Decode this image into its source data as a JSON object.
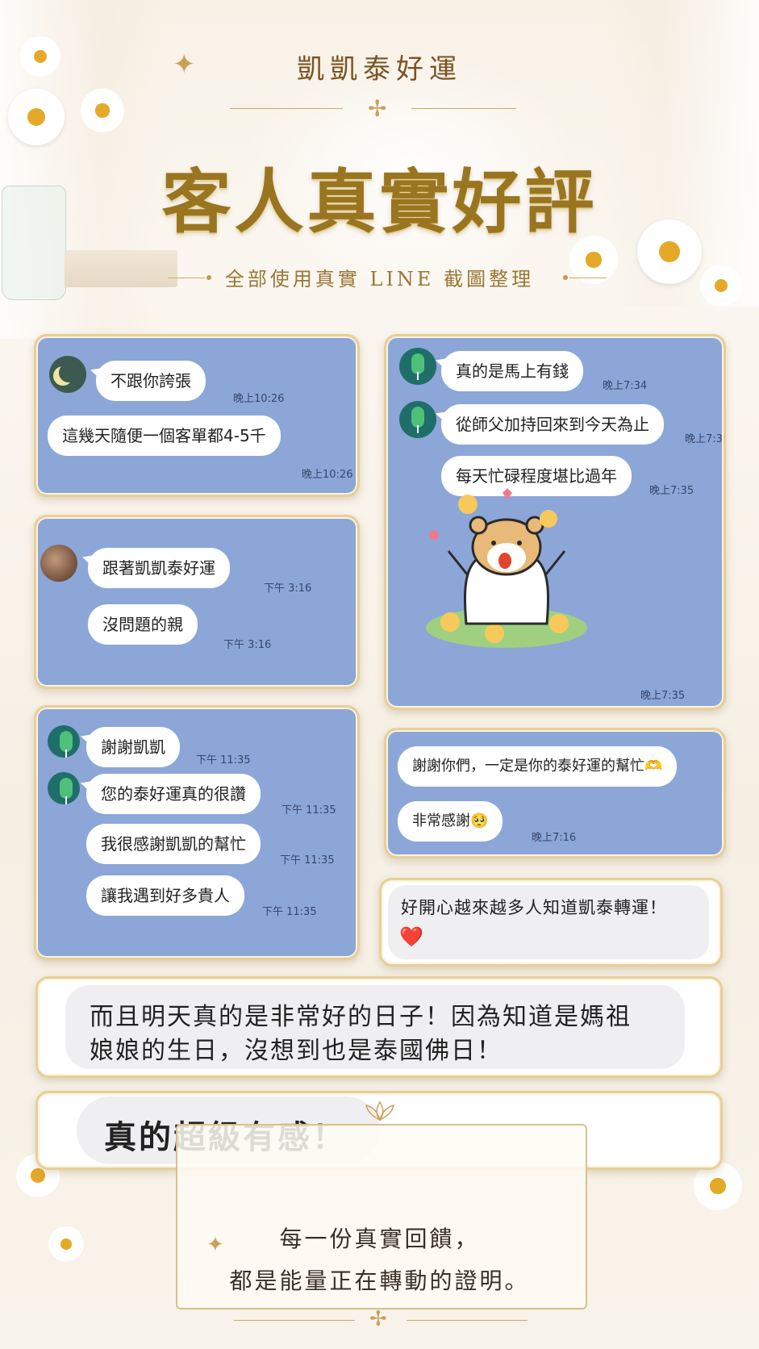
{
  "header": {
    "brand": "凱凱泰好運",
    "title": "客人真實好評",
    "subtitle": "全部使用真實 LINE 截圖整理"
  },
  "card1": {
    "msg1": "不跟你誇張",
    "time1": "晚上10:26",
    "msg2": "這幾天隨便一個客單都4-5千",
    "time2": "晚上10:26"
  },
  "card2": {
    "msg1": "跟著凱凱泰好運",
    "time1": "下午 3:16",
    "msg2": "沒問題的親",
    "time2": "下午 3:16"
  },
  "card3": {
    "msg1": "真的是馬上有錢",
    "time1": "晚上7:34",
    "msg2": "從師父加持回來到今天為止",
    "time2": "晚上7:3",
    "msg3": "每天忙碌程度堪比過年",
    "time3": "晚上7:35",
    "time4": "晚上7:35"
  },
  "card4": {
    "msg1": "謝謝凱凱",
    "time1": "下午 11:35",
    "msg2": "您的泰好運真的很讚",
    "time2": "下午 11:35",
    "msg3": "我很感謝凱凱的幫忙",
    "time3": "下午 11:35",
    "msg4": "讓我遇到好多貴人",
    "time4": "下午 11:35"
  },
  "card5": {
    "msg1": "謝謝你們，一定是你的泰好運的幫忙🫶",
    "msg2": "非常感謝🥺",
    "time2": "晚上7:16"
  },
  "card6": {
    "msg1": "好開心越來越多人知道凱泰轉運！",
    "heart": "❤️"
  },
  "card7": {
    "line1": "而且明天真的是非常好的日子！因為知道是媽祖",
    "line2": "娘娘的生日，沒想到也是泰國佛日！"
  },
  "card8": {
    "msg": "真的超級有感！"
  },
  "footer": {
    "line1": "每一份真實回饋，",
    "line2": "都是能量正在轉動的證明。"
  }
}
